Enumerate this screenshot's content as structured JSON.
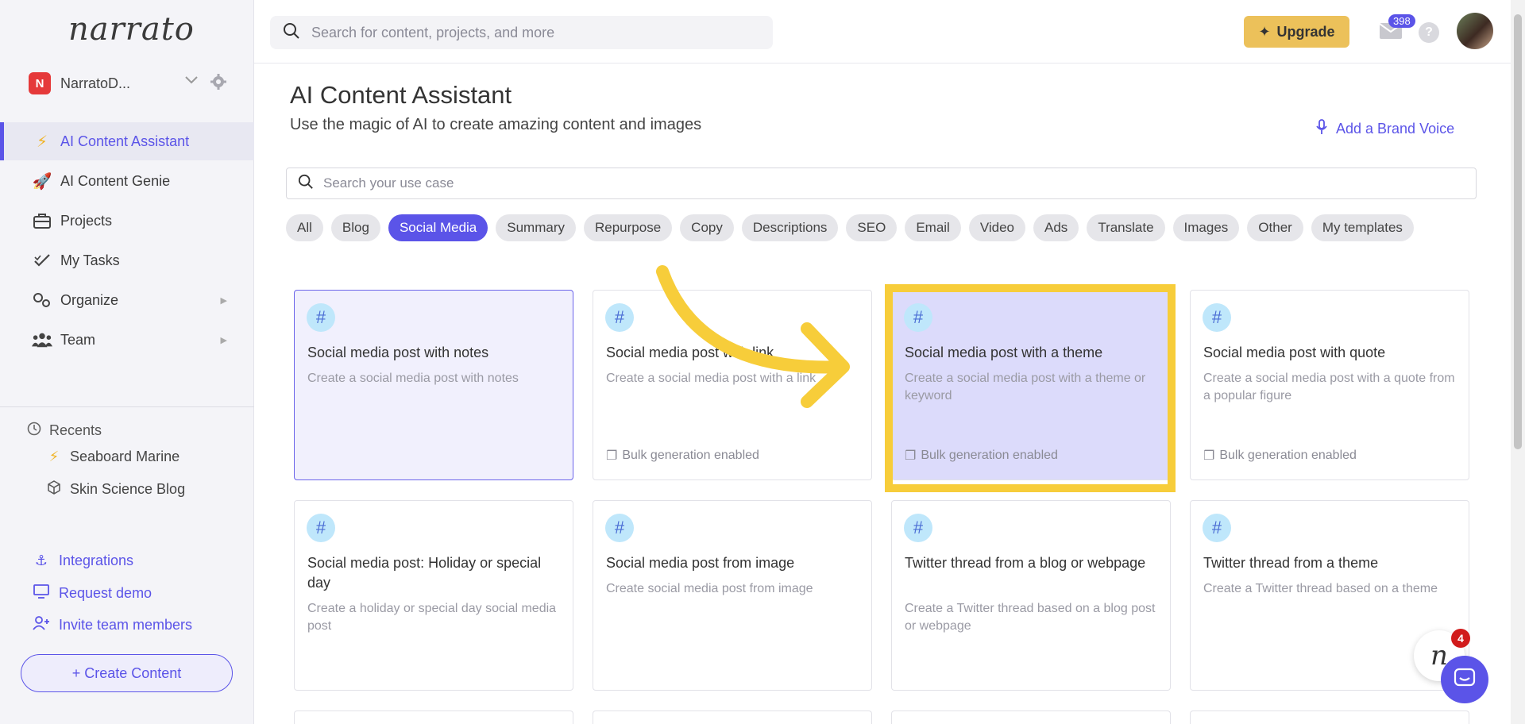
{
  "sidebar": {
    "logo": "narrato",
    "workspace": {
      "badge": "N",
      "name": "NarratoD..."
    },
    "nav": [
      {
        "label": "AI Content Assistant",
        "icon": "lightning-icon"
      },
      {
        "label": "AI Content Genie",
        "icon": "rocket-icon"
      },
      {
        "label": "Projects",
        "icon": "briefcase-icon"
      },
      {
        "label": "My Tasks",
        "icon": "checkmark-icon"
      },
      {
        "label": "Organize",
        "icon": "gears-icon"
      },
      {
        "label": "Team",
        "icon": "people-icon"
      }
    ],
    "recents_title": "Recents",
    "recents": [
      {
        "label": "Seaboard Marine",
        "icon": "lightning-icon"
      },
      {
        "label": "Skin Science Blog",
        "icon": "cube-icon"
      }
    ],
    "links": [
      {
        "label": "Integrations",
        "icon": "anchor-icon"
      },
      {
        "label": "Request demo",
        "icon": "monitor-icon"
      },
      {
        "label": "Invite team members",
        "icon": "add-user-icon"
      }
    ],
    "create_button": "+ Create Content"
  },
  "topbar": {
    "search_placeholder": "Search for content, projects, and more",
    "upgrade_label": "Upgrade",
    "mail_count": "398",
    "help_label": "?"
  },
  "main": {
    "title": "AI Content Assistant",
    "subtitle": "Use the magic of AI to create amazing content and images",
    "brand_voice": "Add a Brand Voice",
    "usecase_placeholder": "Search your use case",
    "filters": [
      "All",
      "Blog",
      "Social Media",
      "Summary",
      "Repurpose",
      "Copy",
      "Descriptions",
      "SEO",
      "Email",
      "Video",
      "Ads",
      "Translate",
      "Images",
      "Other",
      "My templates"
    ],
    "active_filter": "Social Media",
    "cards": [
      {
        "title": "Social media post with notes",
        "desc": "Create a social media post with notes",
        "bulk": ""
      },
      {
        "title": "Social media post with link",
        "desc": "Create a social media post with a link",
        "bulk": "Bulk generation enabled"
      },
      {
        "title": "Social media post with a theme",
        "desc": "Create a social media post with a theme or keyword",
        "bulk": "Bulk generation enabled"
      },
      {
        "title": "Social media post with quote",
        "desc": "Create a social media post with a quote from a popular figure",
        "bulk": "Bulk generation enabled"
      },
      {
        "title": "Social media post: Holiday or special day",
        "desc": "Create a holiday or special day social media post",
        "bulk": ""
      },
      {
        "title": "Social media post from image",
        "desc": "Create social media post from image",
        "bulk": ""
      },
      {
        "title": "Twitter thread from a blog or webpage",
        "desc": "Create a Twitter thread based on a blog post or webpage",
        "bulk": ""
      },
      {
        "title": "Twitter thread from a theme",
        "desc": "Create a Twitter thread based on a theme",
        "bulk": ""
      }
    ]
  },
  "widgets": {
    "notification_count": "4",
    "bubble_letter": "n"
  },
  "colors": {
    "accent": "#5b54e8",
    "highlight": "#f7cd3a",
    "upgrade": "#ecc15a"
  }
}
